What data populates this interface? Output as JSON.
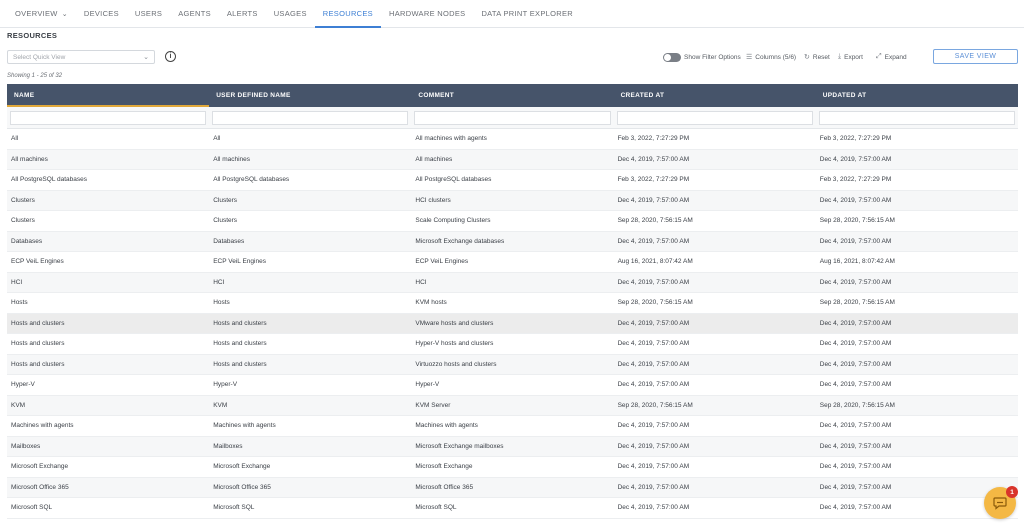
{
  "nav": {
    "tabs": [
      {
        "label": "OVERVIEW"
      },
      {
        "label": "DEVICES"
      },
      {
        "label": "USERS"
      },
      {
        "label": "AGENTS"
      },
      {
        "label": "ALERTS"
      },
      {
        "label": "USAGES"
      },
      {
        "label": "RESOURCES"
      },
      {
        "label": "HARDWARE NODES"
      },
      {
        "label": "DATA PRINT EXPLORER"
      }
    ],
    "active_tab": "RESOURCES"
  },
  "page": {
    "title": "RESOURCES",
    "showing": "Showing 1 - 25 of 32"
  },
  "quick_view": {
    "placeholder": "Select Quick View"
  },
  "toolbar": {
    "show_filter_options": "Show Filter Options",
    "columns": "Columns (5/6)",
    "reset": "Reset",
    "export": "Export",
    "expand": "Expand",
    "save_view": "SAVE VIEW"
  },
  "table": {
    "columns": [
      "NAME",
      "USER DEFINED NAME",
      "COMMENT",
      "CREATED AT",
      "UPDATED AT"
    ],
    "sorted_column": "NAME",
    "rows": [
      [
        "All",
        "All",
        "All machines with agents",
        "Feb 3, 2022, 7:27:29 PM",
        "Feb 3, 2022, 7:27:29 PM"
      ],
      [
        "All machines",
        "All machines",
        "All machines",
        "Dec 4, 2019, 7:57:00 AM",
        "Dec 4, 2019, 7:57:00 AM"
      ],
      [
        "All PostgreSQL databases",
        "All PostgreSQL databases",
        "All PostgreSQL databases",
        "Feb 3, 2022, 7:27:29 PM",
        "Feb 3, 2022, 7:27:29 PM"
      ],
      [
        "Clusters",
        "Clusters",
        "HCI clusters",
        "Dec 4, 2019, 7:57:00 AM",
        "Dec 4, 2019, 7:57:00 AM"
      ],
      [
        "Clusters",
        "Clusters",
        "Scale Computing Clusters",
        "Sep 28, 2020, 7:56:15 AM",
        "Sep 28, 2020, 7:56:15 AM"
      ],
      [
        "Databases",
        "Databases",
        "Microsoft Exchange databases",
        "Dec 4, 2019, 7:57:00 AM",
        "Dec 4, 2019, 7:57:00 AM"
      ],
      [
        "ECP VeiL Engines",
        "ECP VeiL Engines",
        "ECP VeiL Engines",
        "Aug 16, 2021, 8:07:42 AM",
        "Aug 16, 2021, 8:07:42 AM"
      ],
      [
        "HCI",
        "HCI",
        "HCI",
        "Dec 4, 2019, 7:57:00 AM",
        "Dec 4, 2019, 7:57:00 AM"
      ],
      [
        "Hosts",
        "Hosts",
        "KVM hosts",
        "Sep 28, 2020, 7:56:15 AM",
        "Sep 28, 2020, 7:56:15 AM"
      ],
      [
        "Hosts and clusters",
        "Hosts and clusters",
        "VMware hosts and clusters",
        "Dec 4, 2019, 7:57:00 AM",
        "Dec 4, 2019, 7:57:00 AM"
      ],
      [
        "Hosts and clusters",
        "Hosts and clusters",
        "Hyper-V hosts and clusters",
        "Dec 4, 2019, 7:57:00 AM",
        "Dec 4, 2019, 7:57:00 AM"
      ],
      [
        "Hosts and clusters",
        "Hosts and clusters",
        "Virtuozzo hosts and clusters",
        "Dec 4, 2019, 7:57:00 AM",
        "Dec 4, 2019, 7:57:00 AM"
      ],
      [
        "Hyper-V",
        "Hyper-V",
        "Hyper-V",
        "Dec 4, 2019, 7:57:00 AM",
        "Dec 4, 2019, 7:57:00 AM"
      ],
      [
        "KVM",
        "KVM",
        "KVM Server",
        "Sep 28, 2020, 7:56:15 AM",
        "Sep 28, 2020, 7:56:15 AM"
      ],
      [
        "Machines with agents",
        "Machines with agents",
        "Machines with agents",
        "Dec 4, 2019, 7:57:00 AM",
        "Dec 4, 2019, 7:57:00 AM"
      ],
      [
        "Mailboxes",
        "Mailboxes",
        "Microsoft Exchange mailboxes",
        "Dec 4, 2019, 7:57:00 AM",
        "Dec 4, 2019, 7:57:00 AM"
      ],
      [
        "Microsoft Exchange",
        "Microsoft Exchange",
        "Microsoft Exchange",
        "Dec 4, 2019, 7:57:00 AM",
        "Dec 4, 2019, 7:57:00 AM"
      ],
      [
        "Microsoft Office 365",
        "Microsoft Office 365",
        "Microsoft Office 365",
        "Dec 4, 2019, 7:57:00 AM",
        "Dec 4, 2019, 7:57:00 AM"
      ],
      [
        "Microsoft SQL",
        "Microsoft SQL",
        "Microsoft SQL",
        "Dec 4, 2019, 7:57:00 AM",
        "Dec 4, 2019, 7:57:00 AM"
      ]
    ]
  },
  "chat": {
    "badge_count": "1"
  },
  "icons": {
    "info": "info-icon",
    "columns": "columns-icon",
    "reset": "reset-icon",
    "export": "export-icon",
    "expand": "expand-icon",
    "chat": "chat-bubble-icon"
  },
  "colors": {
    "accent": "#3d7fd4",
    "header_bg": "#46546a",
    "sort_indicator": "#e0a83a",
    "chat_button": "#f4b844",
    "badge": "#d9342b"
  }
}
